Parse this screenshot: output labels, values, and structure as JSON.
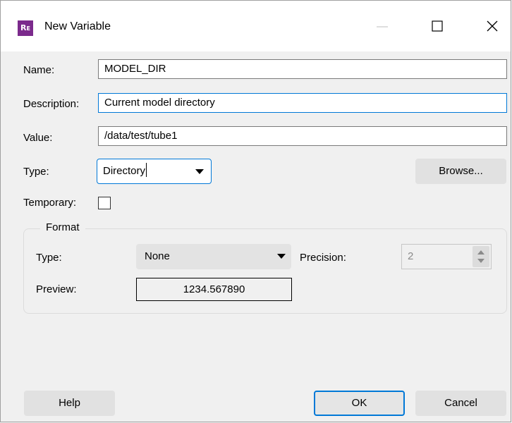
{
  "window": {
    "title": "New Variable",
    "app_icon_text": "RE"
  },
  "form": {
    "name_label": "Name:",
    "name_value": "MODEL_DIR",
    "description_label": "Description:",
    "description_value": "Current model directory",
    "value_label": "Value:",
    "value_value": "/data/test/tube1",
    "type_label": "Type:",
    "type_value": "Directory",
    "browse_label": "Browse...",
    "temporary_label": "Temporary:",
    "temporary_checked": false
  },
  "format": {
    "group_title": "Format",
    "type_label": "Type:",
    "type_value": "None",
    "precision_label": "Precision:",
    "precision_value": "2",
    "preview_label": "Preview:",
    "preview_value": "1234.567890"
  },
  "buttons": {
    "help_label": "Help",
    "ok_label": "OK",
    "cancel_label": "Cancel"
  },
  "colors": {
    "accent": "#0078d7",
    "app_icon": "#7b2a8c"
  }
}
